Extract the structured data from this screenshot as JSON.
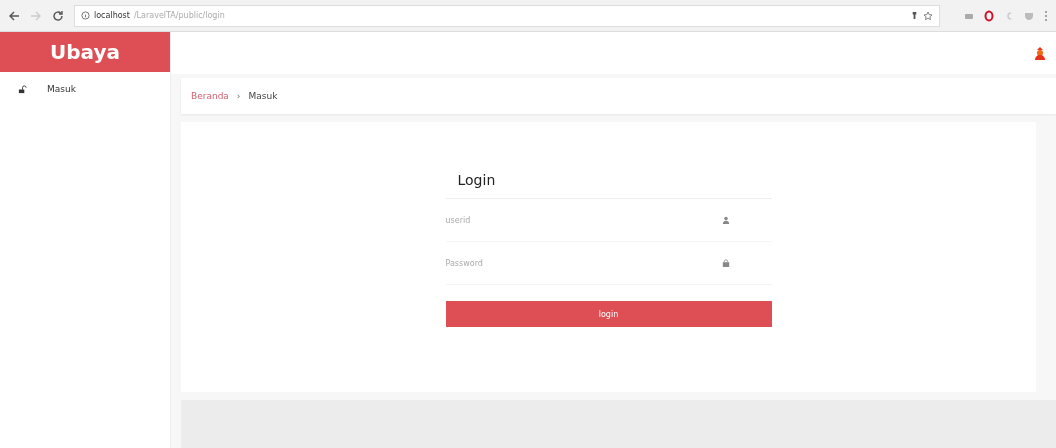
{
  "browser": {
    "url_host": "localhost",
    "url_path": "/LaravelTA/public/login"
  },
  "sidebar": {
    "brand": "Ubaya",
    "items": [
      {
        "label": "Masuk"
      }
    ]
  },
  "breadcrumb": [
    {
      "label": "Beranda",
      "kind": "link"
    },
    {
      "label": "›",
      "kind": "separator"
    },
    {
      "label": "Masuk",
      "kind": "current"
    }
  ],
  "login": {
    "title": "Login",
    "fields": [
      {
        "placeholder": "userid",
        "kind": "user"
      },
      {
        "placeholder": "Password",
        "kind": "password"
      }
    ],
    "button": "login"
  }
}
